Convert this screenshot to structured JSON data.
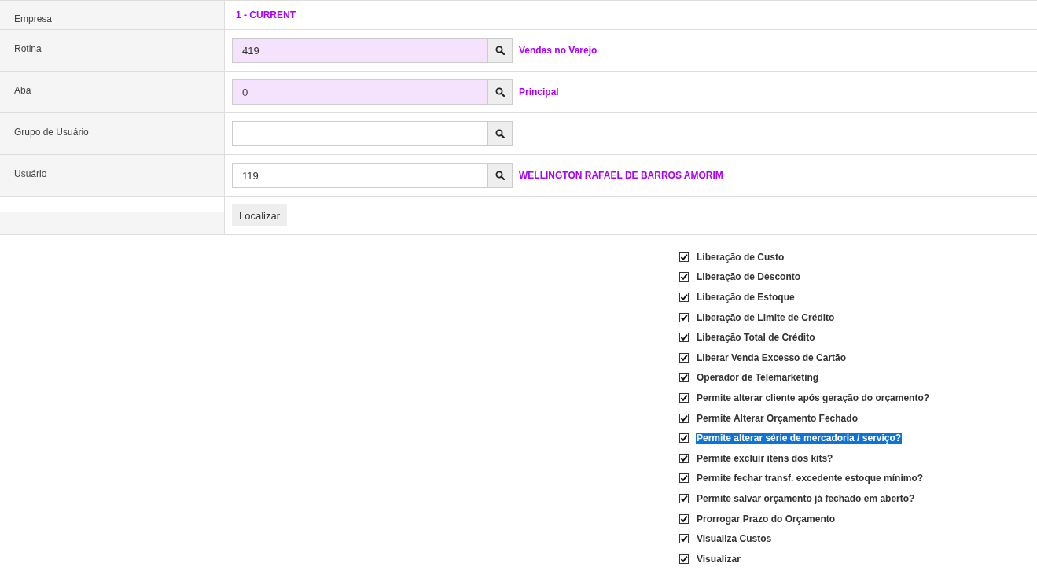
{
  "form": {
    "rows": [
      {
        "kind": "text",
        "label": "Empresa",
        "value": "1 - CURRENT"
      },
      {
        "kind": "lookup",
        "label": "Rotina",
        "value": "419",
        "readonly": true,
        "description": "Vendas no Varejo"
      },
      {
        "kind": "lookup",
        "label": "Aba",
        "value": "0",
        "readonly": true,
        "description": "Principal"
      },
      {
        "kind": "lookup",
        "label": "Grupo de Usuário",
        "value": "",
        "readonly": false
      },
      {
        "kind": "lookup",
        "label": "Usuário",
        "value": "119",
        "readonly": false,
        "description": "WELLINGTON RAFAEL DE BARROS AMORIM"
      },
      {
        "kind": "action",
        "button": "Localizar"
      }
    ]
  },
  "permissions": [
    {
      "label": "Liberação de Custo",
      "checked": true,
      "selected": false
    },
    {
      "label": "Liberação de Desconto",
      "checked": true,
      "selected": false
    },
    {
      "label": "Liberação de Estoque",
      "checked": true,
      "selected": false
    },
    {
      "label": "Liberação de Limite de Crédito",
      "checked": true,
      "selected": false
    },
    {
      "label": "Liberação Total de Crédito",
      "checked": true,
      "selected": false
    },
    {
      "label": "Liberar Venda Excesso de Cartão",
      "checked": true,
      "selected": false
    },
    {
      "label": "Operador de Telemarketing",
      "checked": true,
      "selected": false
    },
    {
      "label": "Permite alterar cliente após geração do orçamento?",
      "checked": true,
      "selected": false
    },
    {
      "label": "Permite Alterar Orçamento Fechado",
      "checked": true,
      "selected": false
    },
    {
      "label": "Permite alterar série de mercadoria / serviço?",
      "checked": true,
      "selected": true
    },
    {
      "label": "Permite excluir itens dos kits?",
      "checked": true,
      "selected": false
    },
    {
      "label": "Permite fechar transf. excedente estoque mínimo?",
      "checked": true,
      "selected": false
    },
    {
      "label": "Permite salvar orçamento já fechado em aberto?",
      "checked": true,
      "selected": false
    },
    {
      "label": "Prorrogar Prazo do Orçamento",
      "checked": true,
      "selected": false
    },
    {
      "label": "Visualiza Custos",
      "checked": true,
      "selected": false
    },
    {
      "label": "Visualizar",
      "checked": true,
      "selected": false
    }
  ]
}
